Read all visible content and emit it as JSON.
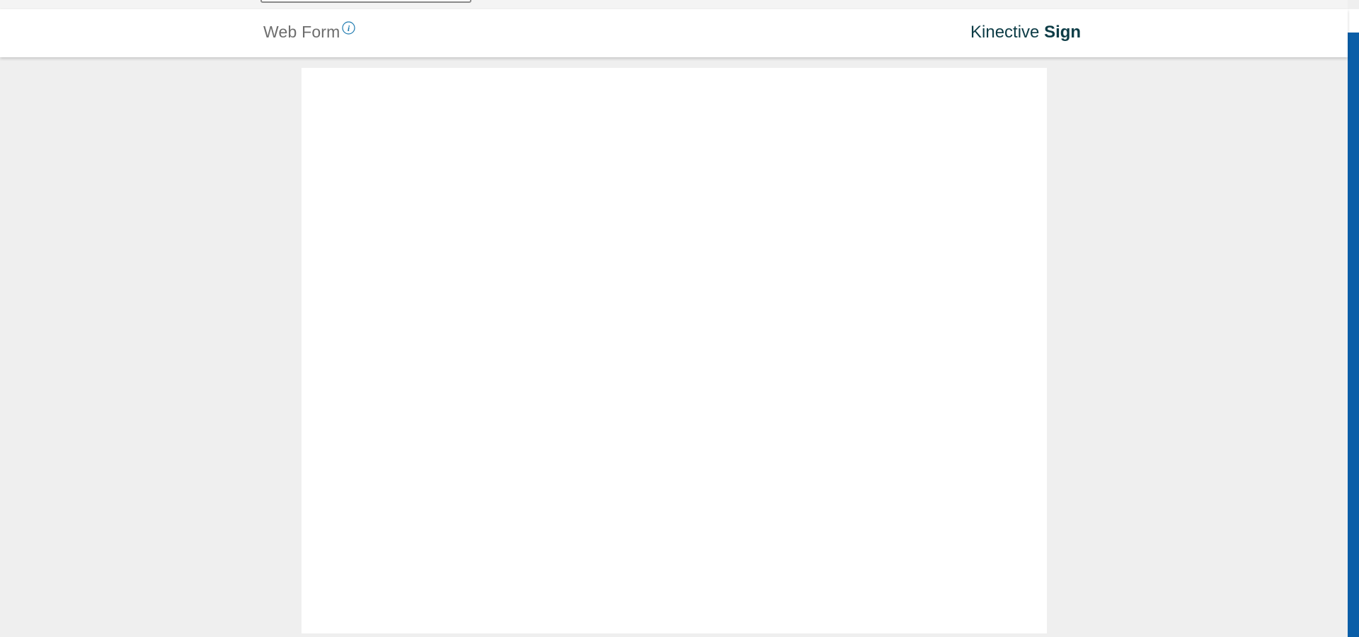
{
  "header": {
    "title": "Web Form",
    "info_icon": "info-icon",
    "brand_light": "Kinective",
    "brand_bold": "Sign"
  },
  "colors": {
    "brand_text": "#0d3c46",
    "title_text": "#6d6d6d",
    "info_icon": "#1f7bb0",
    "scrollbar_thumb": "#0a5ea8",
    "background": "#efefef"
  }
}
